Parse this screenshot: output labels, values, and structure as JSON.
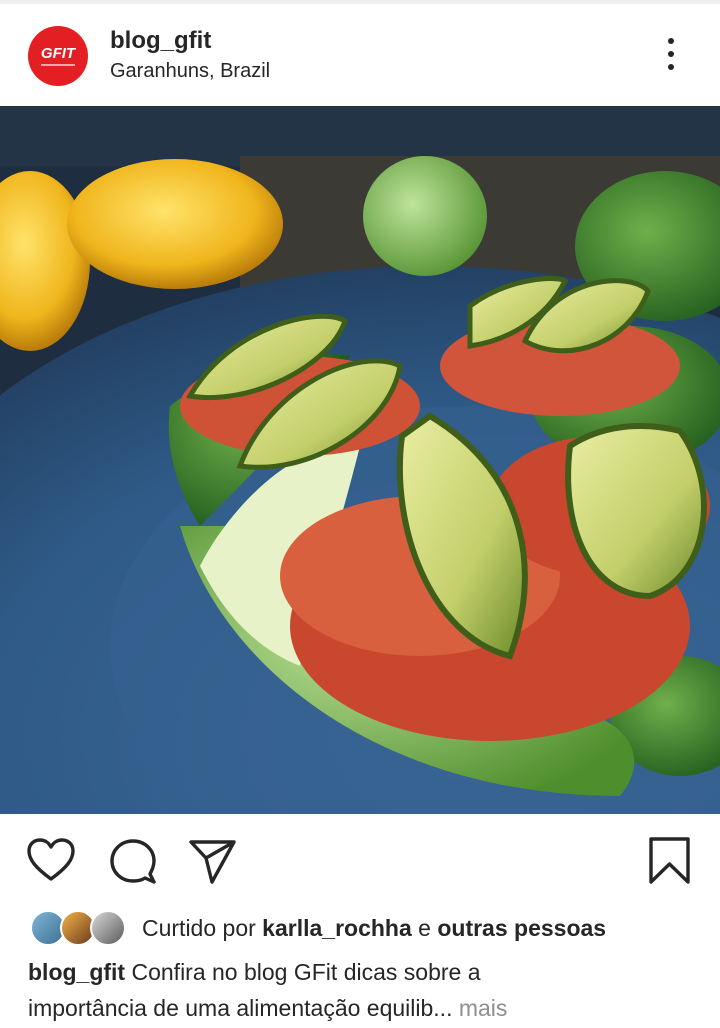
{
  "post": {
    "username": "blog_gfit",
    "location": "Garanhuns, Brazil",
    "avatar_text": "GFIT",
    "brand_color": "#e41f24"
  },
  "actions": {
    "like_icon": "heart-icon",
    "comment_icon": "comment-icon",
    "share_icon": "send-icon",
    "save_icon": "bookmark-icon"
  },
  "likes": {
    "prefix": "Curtido por",
    "user": "karlla_rochha",
    "joiner": "e",
    "others": "outras pessoas"
  },
  "caption": {
    "username": "blog_gfit",
    "line1": "Confira no blog GFit dicas sobre a",
    "line2": "importância de uma alimentação equilib",
    "ellipsis": "...",
    "more": "mais"
  }
}
